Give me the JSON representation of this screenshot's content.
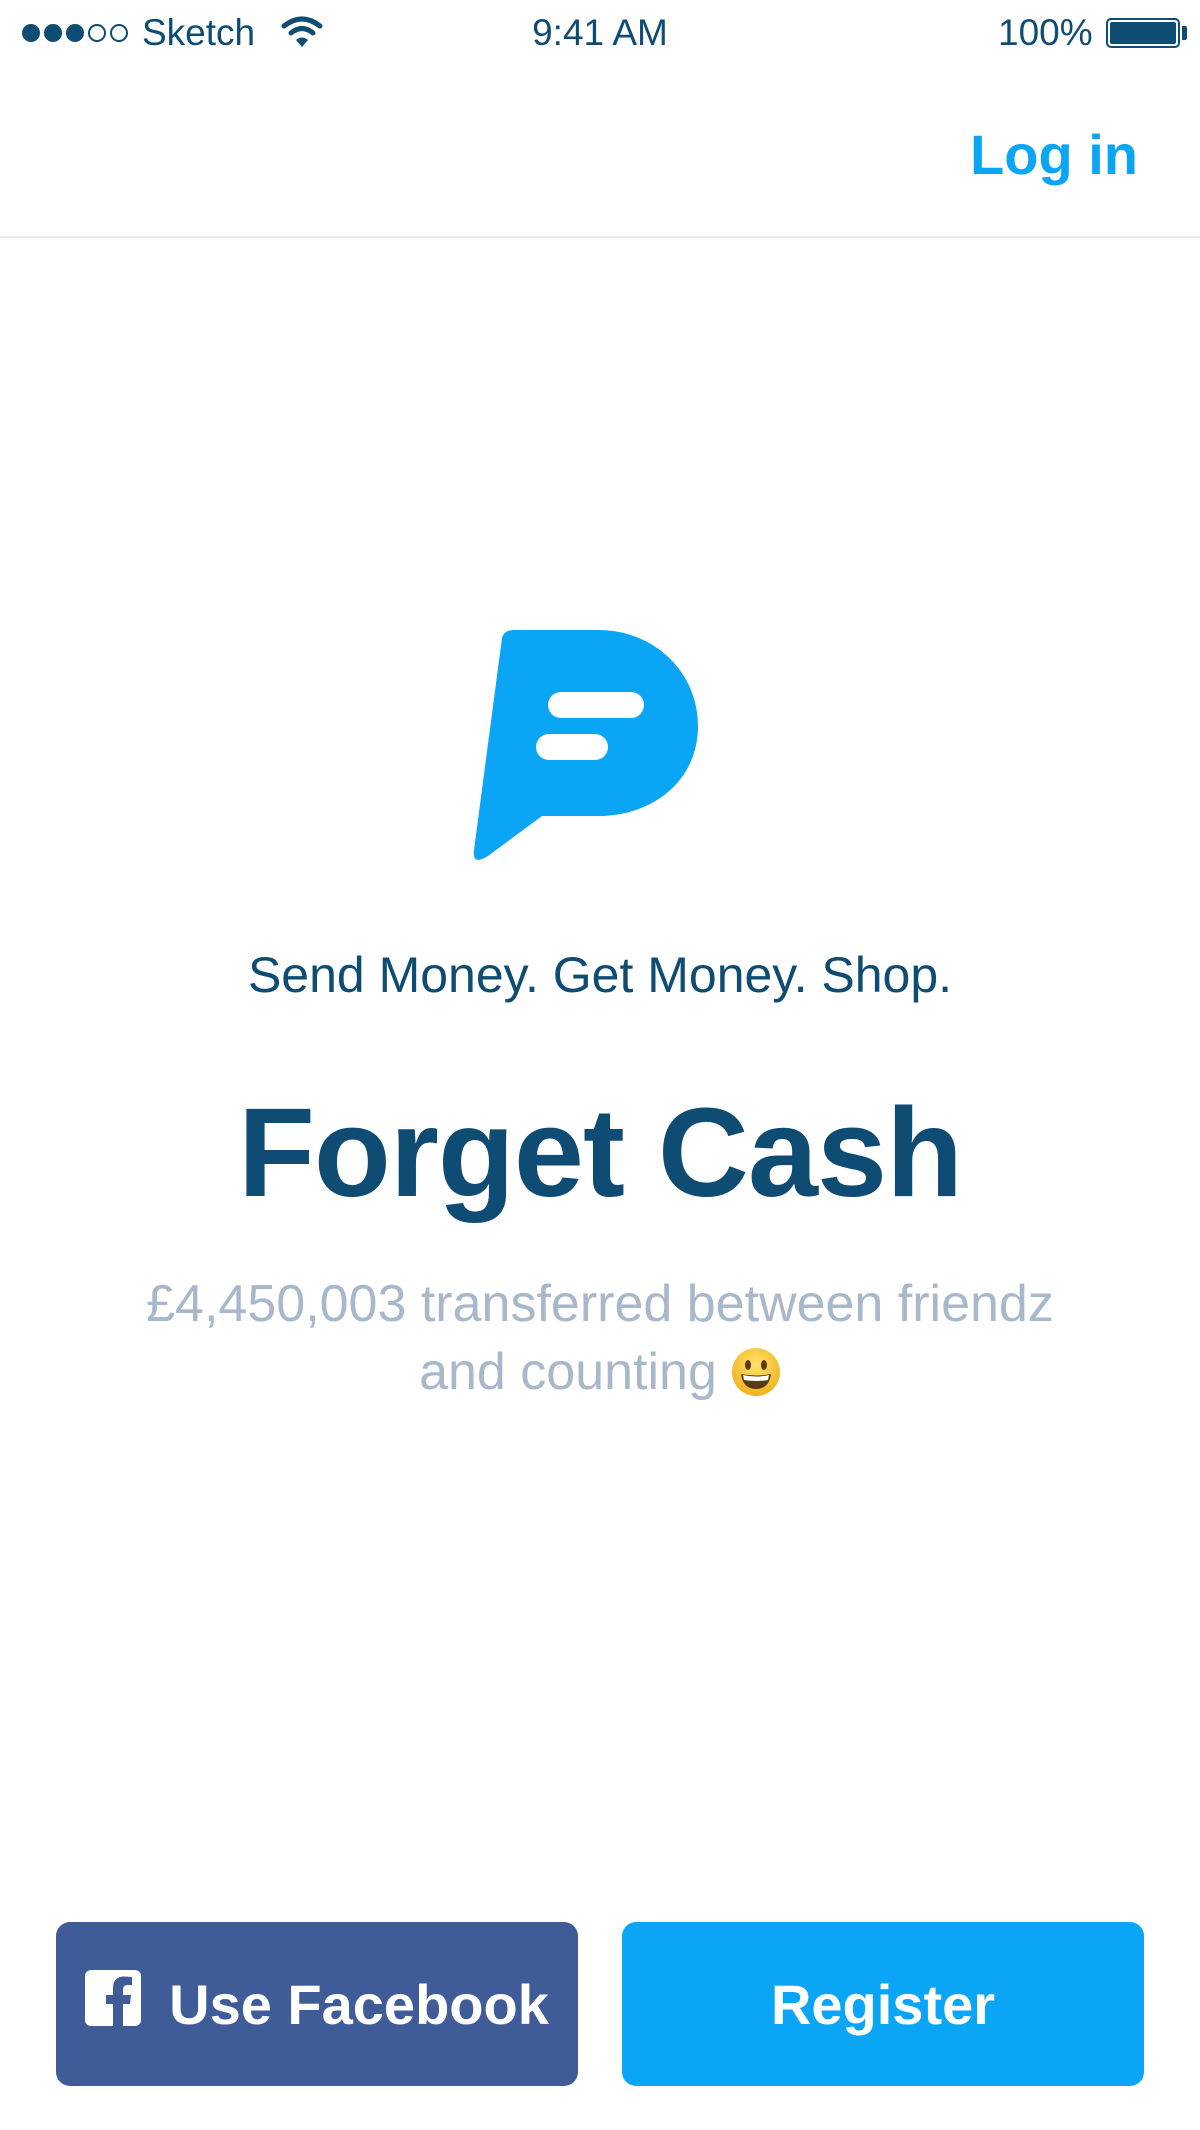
{
  "status_bar": {
    "carrier": "Sketch",
    "time": "9:41 AM",
    "battery": "100%",
    "signal_bars_filled": 3,
    "signal_bars_total": 5
  },
  "nav": {
    "login_label": "Log in"
  },
  "hero": {
    "tagline": "Send Money. Get Money. Shop.",
    "headline": "Forget Cash",
    "stats_line1": "£4,450,003 transferred between friendz",
    "stats_line2": "and counting"
  },
  "buttons": {
    "facebook_label": "Use Facebook",
    "register_label": "Register"
  },
  "colors": {
    "accent": "#0aa5f5",
    "text_dark": "#0f4c73",
    "text_muted": "#a9b7ca",
    "facebook": "#3f5b98"
  },
  "icons": [
    "signal-icon",
    "wifi-icon",
    "battery-icon",
    "brand-logo-icon",
    "grinning-face-emoji",
    "facebook-icon"
  ]
}
